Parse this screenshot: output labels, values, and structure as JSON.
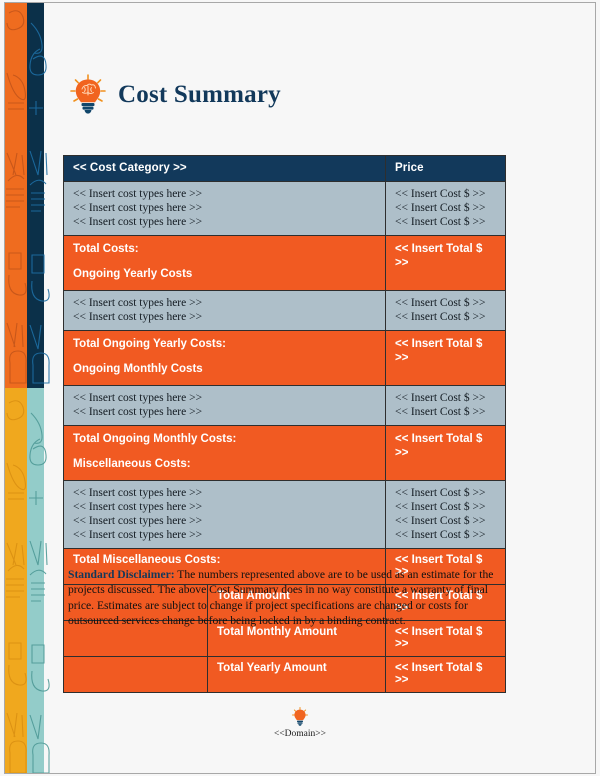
{
  "document": {
    "title": "Cost Summary",
    "header_icon": "lightbulb-brain-icon"
  },
  "colors": {
    "navy": "#12395b",
    "orange": "#f15a22",
    "light_blue_grey": "#aebfc9",
    "stripe_orange": "#ef6c1f",
    "stripe_navy": "#0b3049",
    "stripe_amber": "#f0a81e",
    "stripe_teal": "#93ccc9",
    "page_background": "#f7f7f7"
  },
  "table": {
    "headers": {
      "category": "<< Cost Category >>",
      "price": "Price"
    },
    "sections": [
      {
        "type": "items",
        "rows": [
          {
            "label": "<< Insert cost types here >>",
            "price": "<< Insert Cost $ >>"
          },
          {
            "label": "<< Insert cost types here >>",
            "price": "<< Insert Cost $ >>"
          },
          {
            "label": "<< Insert cost types here >>",
            "price": "<< Insert Cost $ >>"
          }
        ]
      },
      {
        "type": "total",
        "total_label": "Total Costs:",
        "next_section_label": "Ongoing Yearly Costs",
        "price": "<< Insert Total $ >>"
      },
      {
        "type": "items",
        "rows": [
          {
            "label": "<< Insert cost types here >>",
            "price": "<< Insert Cost $ >>"
          },
          {
            "label": "<< Insert cost types here >>",
            "price": "<< Insert Cost $ >>"
          }
        ]
      },
      {
        "type": "total",
        "total_label": "Total Ongoing Yearly Costs:",
        "next_section_label": "Ongoing Monthly Costs",
        "price": "<< Insert Total $ >>"
      },
      {
        "type": "items",
        "rows": [
          {
            "label": "<< Insert cost types here >>",
            "price": "<< Insert Cost $ >>"
          },
          {
            "label": "<< Insert cost types here >>",
            "price": "<< Insert Cost $ >>"
          }
        ]
      },
      {
        "type": "total",
        "total_label": "Total Ongoing Monthly Costs:",
        "next_section_label": "Miscellaneous Costs:",
        "price": "<< Insert Total $ >>"
      },
      {
        "type": "items",
        "rows": [
          {
            "label": "<< Insert cost types here >>",
            "price": "<< Insert Cost $ >>"
          },
          {
            "label": "<< Insert cost types here >>",
            "price": "<< Insert Cost $ >>"
          },
          {
            "label": "<< Insert cost types here >>",
            "price": "<< Insert Cost $ >>"
          },
          {
            "label": "<< Insert cost types here >>",
            "price": "<< Insert Cost $ >>"
          }
        ]
      }
    ],
    "misc_total": {
      "label": "Total Miscellaneous Costs:",
      "price": "<< Insert Total $ >>"
    },
    "grand_totals": [
      {
        "label": "Total Amount",
        "price": "<< Insert Total $ >>"
      },
      {
        "label": "Total Monthly Amount",
        "price": "<< Insert Total $ >>"
      },
      {
        "label": "Total Yearly Amount",
        "price": "<< Insert Total $ >>"
      }
    ]
  },
  "disclaimer": {
    "heading": "Standard Disclaimer:",
    "body": " The numbers represented above are to be used as an estimate for the projects discussed. The above Cost Summary does in no way constitute a warranty of final price.  Estimates are subject to change if project specifications are changed or costs for outsourced services change before being locked in by a binding contract."
  },
  "footer": {
    "icon": "lightbulb-icon",
    "text": "<<Domain>>"
  }
}
